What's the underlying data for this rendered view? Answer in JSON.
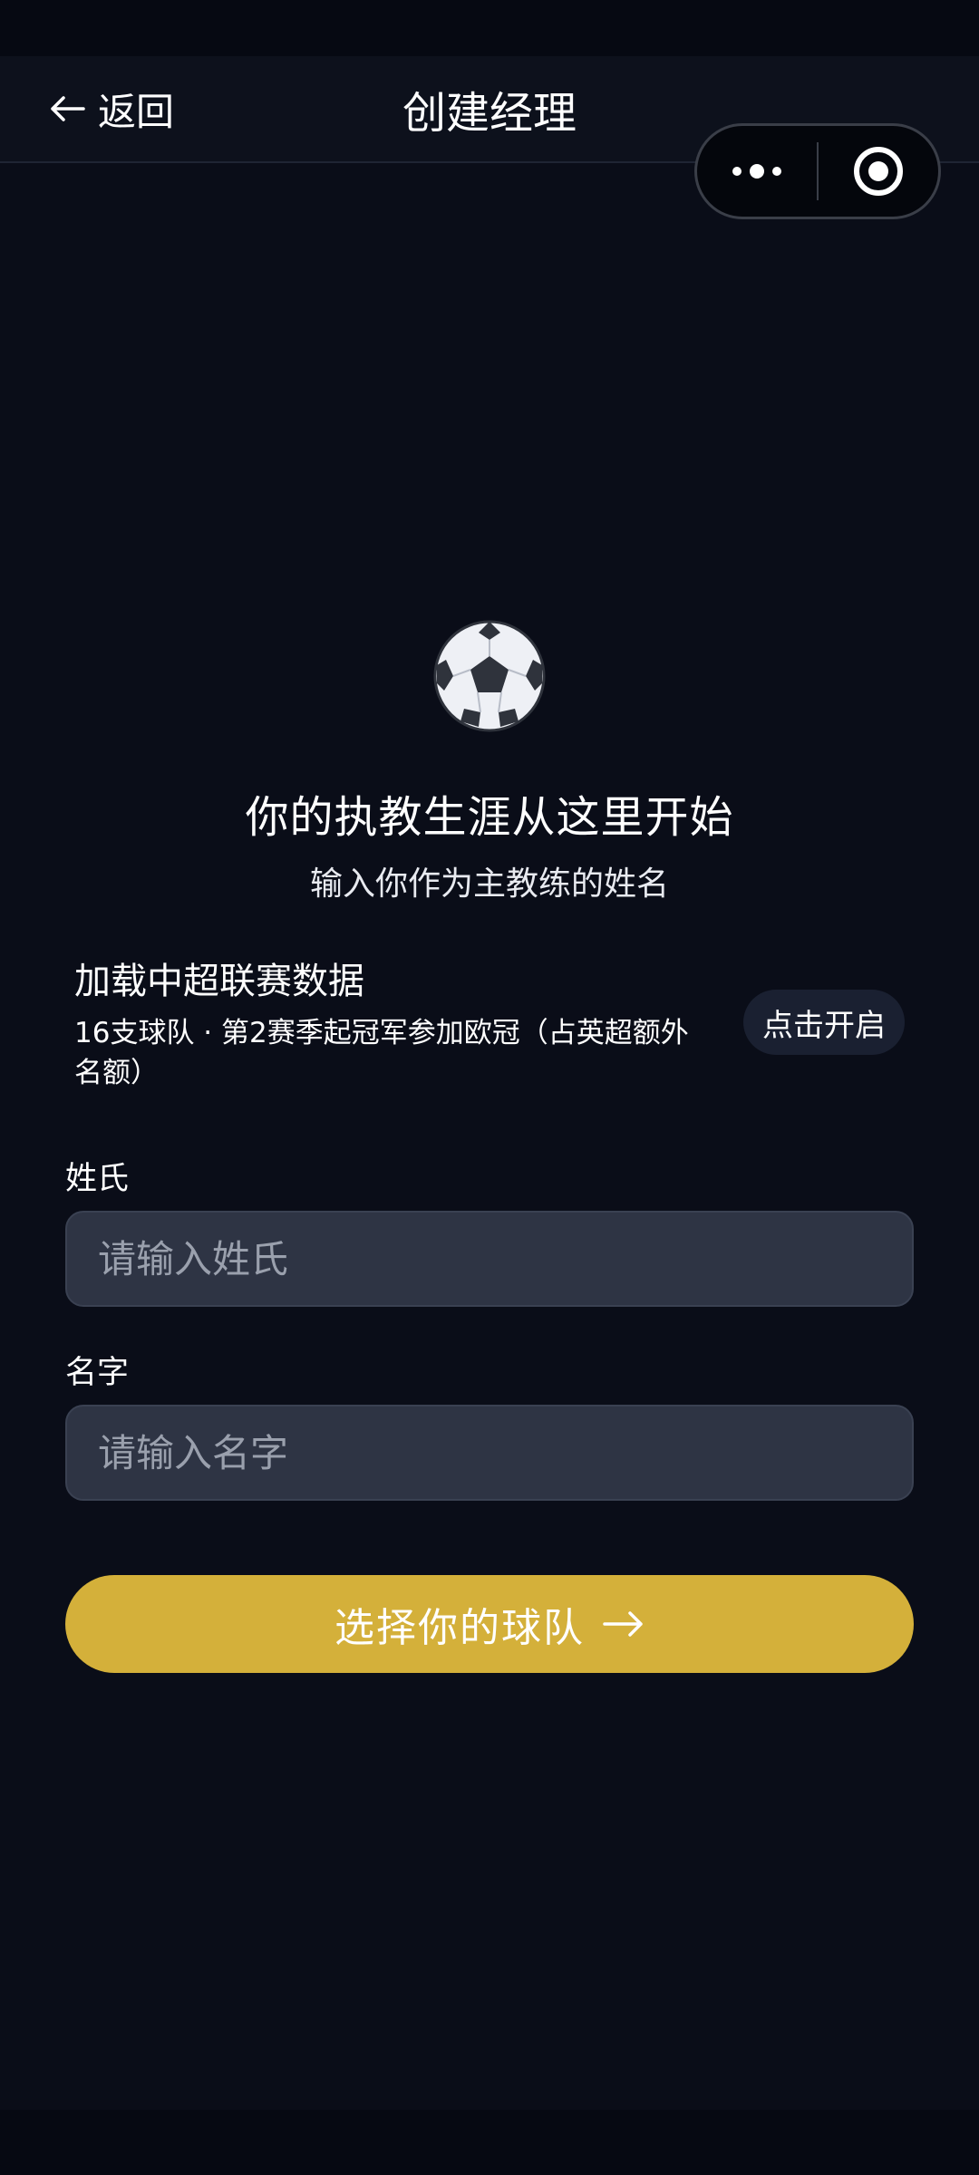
{
  "nav": {
    "back_label": "返回",
    "title": "创建经理"
  },
  "capsule": {
    "more_icon": "more-dots-icon",
    "close_icon": "target-circle-icon"
  },
  "hero": {
    "icon": "soccer-ball-icon",
    "heading": "你的执教生涯从这里开始",
    "subheading": "输入你作为主教练的姓名"
  },
  "league": {
    "title": "加载中超联赛数据",
    "description": "16支球队 · 第2赛季起冠军参加欧冠（占英超额外名额）",
    "button_label": "点击开启"
  },
  "form": {
    "surname_label": "姓氏",
    "surname_placeholder": "请输入姓氏",
    "surname_value": "",
    "given_name_label": "名字",
    "given_name_placeholder": "请输入名字",
    "given_name_value": ""
  },
  "submit": {
    "label": "选择你的球队",
    "icon": "arrow-right-icon"
  },
  "colors": {
    "background": "#0a0d18",
    "input_background": "#2e3444",
    "accent_button": "#d4b03a"
  }
}
